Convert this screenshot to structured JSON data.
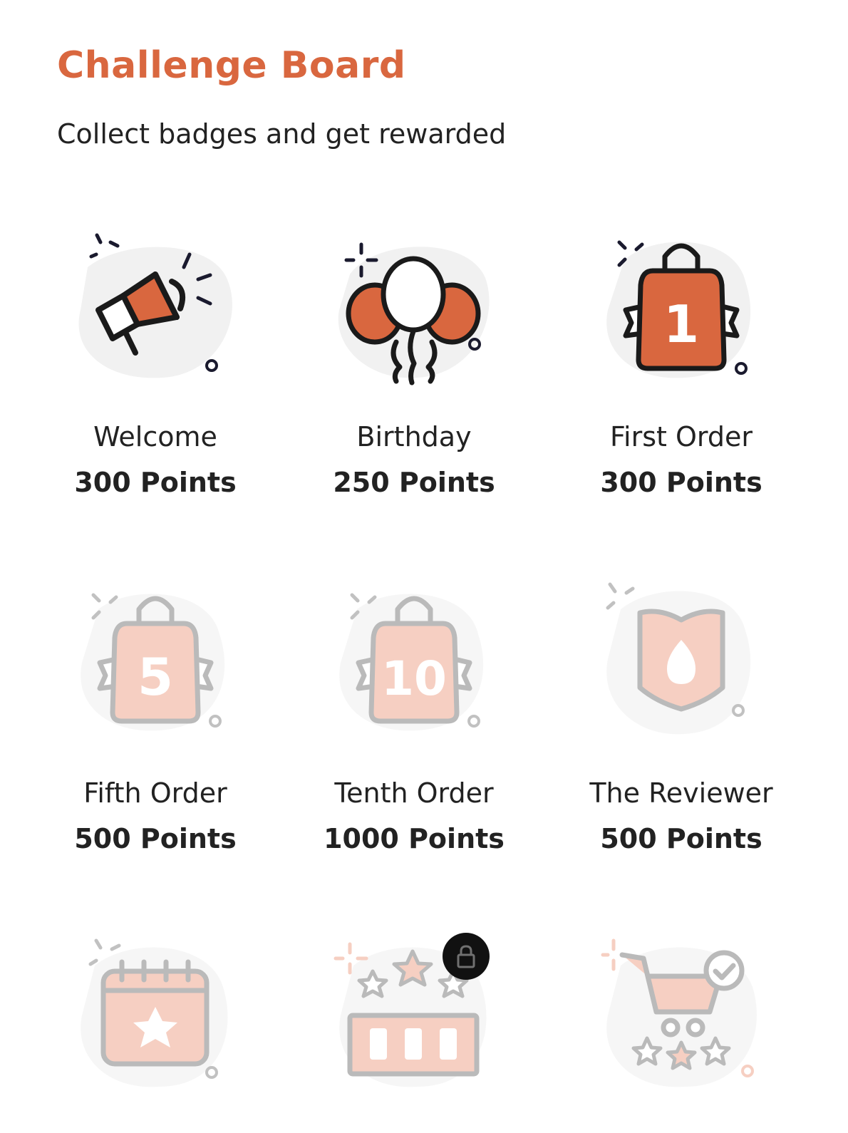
{
  "header": {
    "title": "Challenge Board",
    "subtitle": "Collect badges and get rewarded"
  },
  "colors": {
    "accent": "#d9673f",
    "text": "#222222",
    "locked_fill": "#f5c9b8",
    "locked_stroke": "#9a9a9a"
  },
  "badges": [
    {
      "name": "Welcome",
      "points": "300 Points",
      "icon": "megaphone-icon",
      "unlocked": true
    },
    {
      "name": "Birthday",
      "points": "250 Points",
      "icon": "balloons-icon",
      "unlocked": true
    },
    {
      "name": "First Order",
      "points": "300 Points",
      "icon": "shopping-bag-1-icon",
      "unlocked": true,
      "icon_text": "1"
    },
    {
      "name": "Fifth Order",
      "points": "500 Points",
      "icon": "shopping-bag-5-icon",
      "unlocked": false,
      "icon_text": "5"
    },
    {
      "name": "Tenth Order",
      "points": "1000 Points",
      "icon": "shopping-bag-10-icon",
      "unlocked": false,
      "icon_text": "10"
    },
    {
      "name": "The Reviewer",
      "points": "500 Points",
      "icon": "fire-shield-icon",
      "unlocked": false
    },
    {
      "icon": "calendar-star-icon",
      "unlocked": false
    },
    {
      "icon": "rating-stars-icon",
      "unlocked": false,
      "lock_icon": "lock-icon"
    },
    {
      "icon": "cart-rating-icon",
      "unlocked": false
    }
  ]
}
